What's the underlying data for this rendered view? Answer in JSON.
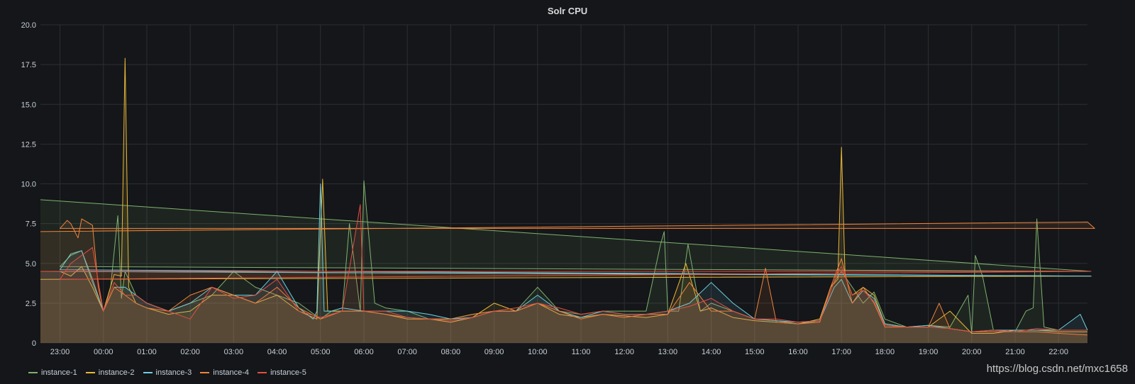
{
  "chart_data": {
    "type": "line",
    "title": "Solr CPU",
    "ylim": [
      0,
      20
    ],
    "y_ticks": [
      "0",
      "2.5",
      "5.0",
      "7.5",
      "10.0",
      "12.5",
      "15.0",
      "17.5",
      "20.0"
    ],
    "x_ticks": [
      "23:00",
      "00:00",
      "01:00",
      "02:00",
      "03:00",
      "04:00",
      "05:00",
      "06:00",
      "07:00",
      "08:00",
      "09:00",
      "10:00",
      "11:00",
      "12:00",
      "13:00",
      "14:00",
      "15:00",
      "16:00",
      "17:00",
      "18:00",
      "19:00",
      "20:00",
      "21:00",
      "22:00"
    ],
    "x_range": [
      "22:33",
      "22:40"
    ],
    "grid": true,
    "legend_position": "bottom-left",
    "series": [
      {
        "name": "instance-1",
        "color": "#7eb26d",
        "x": [
          "22:33",
          "22:45",
          "23:00",
          "23:15",
          "23:30",
          "23:45",
          "00:00",
          "00:10",
          "00:20",
          "00:25",
          "00:30",
          "00:45",
          "01:00",
          "01:30",
          "02:00",
          "02:30",
          "03:00",
          "03:30",
          "04:00",
          "04:30",
          "05:00",
          "05:15",
          "05:30",
          "05:40",
          "05:55",
          "06:00",
          "06:15",
          "06:30",
          "07:00",
          "07:30",
          "08:00",
          "08:30",
          "09:00",
          "09:30",
          "10:00",
          "10:30",
          "11:00",
          "11:30",
          "12:00",
          "12:30",
          "12:50",
          "12:55",
          "13:00",
          "13:15",
          "13:28",
          "13:45",
          "14:00",
          "14:30",
          "15:00",
          "15:30",
          "16:00",
          "16:30",
          "16:45",
          "17:00",
          "17:15",
          "17:30",
          "17:45",
          "18:00",
          "18:30",
          "19:00",
          "19:30",
          "19:55",
          "20:00",
          "20:05",
          "20:15",
          "20:30",
          "21:00",
          "21:15",
          "21:25",
          "21:30",
          "21:40",
          "22:00",
          "22:40"
        ],
        "y": [
          9.0,
          4.5,
          4.8,
          5.5,
          5.8,
          3.8,
          2.0,
          3.5,
          8.0,
          2.8,
          4.5,
          3.0,
          2.5,
          2.0,
          2.5,
          3.0,
          4.5,
          3.5,
          3.0,
          2.5,
          1.5,
          2.0,
          2.0,
          7.5,
          2.0,
          10.2,
          2.5,
          2.2,
          2.0,
          1.5,
          1.5,
          1.8,
          2.0,
          2.0,
          3.5,
          2.0,
          1.8,
          2.0,
          2.0,
          2.0,
          6.2,
          7.0,
          2.0,
          2.0,
          6.2,
          2.0,
          2.5,
          2.0,
          1.5,
          1.4,
          1.2,
          1.4,
          3.5,
          4.5,
          3.5,
          2.5,
          3.2,
          1.5,
          1.0,
          1.1,
          1.0,
          3.0,
          0.6,
          5.5,
          4.2,
          0.8,
          0.7,
          2.0,
          2.2,
          7.8,
          1.0,
          0.8,
          0.8
        ]
      },
      {
        "name": "instance-2",
        "color": "#eab839",
        "x": [
          "22:33",
          "22:45",
          "23:00",
          "23:15",
          "23:30",
          "23:45",
          "00:00",
          "00:15",
          "00:25",
          "00:30",
          "00:35",
          "00:45",
          "01:00",
          "01:30",
          "02:00",
          "02:30",
          "03:00",
          "03:30",
          "04:00",
          "04:30",
          "04:55",
          "05:03",
          "05:10",
          "05:30",
          "06:00",
          "06:30",
          "07:00",
          "07:30",
          "08:00",
          "08:30",
          "09:00",
          "09:30",
          "10:00",
          "10:30",
          "11:00",
          "11:30",
          "12:00",
          "12:30",
          "13:00",
          "13:25",
          "13:45",
          "14:00",
          "14:30",
          "15:00",
          "15:30",
          "16:00",
          "16:30",
          "16:45",
          "16:55",
          "17:00",
          "17:05",
          "17:15",
          "17:30",
          "17:45",
          "18:00",
          "18:30",
          "19:00",
          "19:30",
          "20:00",
          "20:30",
          "21:00",
          "21:30",
          "22:00",
          "22:40"
        ],
        "y": [
          4.0,
          4.2,
          4.5,
          4.2,
          4.8,
          3.5,
          2.0,
          4.3,
          4.2,
          17.9,
          3.5,
          2.5,
          2.2,
          1.8,
          2.0,
          3.0,
          3.0,
          2.5,
          3.0,
          2.0,
          1.5,
          10.3,
          2.0,
          2.0,
          2.0,
          1.8,
          1.5,
          1.5,
          1.3,
          1.6,
          2.5,
          2.0,
          2.5,
          1.8,
          1.6,
          1.8,
          1.7,
          1.6,
          1.8,
          5.0,
          2.0,
          2.2,
          1.6,
          1.4,
          1.3,
          1.2,
          1.5,
          3.5,
          4.0,
          12.3,
          4.2,
          3.0,
          3.5,
          3.0,
          1.2,
          1.0,
          1.0,
          2.0,
          0.6,
          0.6,
          0.8,
          0.8,
          0.7,
          0.7
        ]
      },
      {
        "name": "instance-3",
        "color": "#6ed0e0",
        "x": [
          "22:33",
          "22:45",
          "23:00",
          "23:15",
          "23:30",
          "23:45",
          "00:00",
          "00:15",
          "00:30",
          "00:45",
          "01:00",
          "01:30",
          "02:00",
          "02:30",
          "03:00",
          "03:30",
          "04:00",
          "04:30",
          "04:50",
          "04:55",
          "05:00",
          "05:05",
          "05:15",
          "05:30",
          "06:00",
          "06:30",
          "07:00",
          "07:30",
          "08:00",
          "08:30",
          "09:00",
          "09:30",
          "10:00",
          "10:30",
          "11:00",
          "11:30",
          "12:00",
          "12:30",
          "13:00",
          "13:30",
          "14:00",
          "14:30",
          "15:00",
          "15:30",
          "16:00",
          "16:30",
          "16:50",
          "17:00",
          "17:15",
          "17:30",
          "17:45",
          "18:00",
          "18:30",
          "19:00",
          "19:30",
          "20:00",
          "20:30",
          "21:00",
          "21:30",
          "22:00",
          "22:30",
          "22:40"
        ],
        "y": [
          4.5,
          4.2,
          4.6,
          5.6,
          5.8,
          4.0,
          2.0,
          3.5,
          3.5,
          3.0,
          2.5,
          2.0,
          2.5,
          3.5,
          3.0,
          3.0,
          4.5,
          2.2,
          1.5,
          2.0,
          10.0,
          2.0,
          2.0,
          2.2,
          2.0,
          2.0,
          2.0,
          1.8,
          1.5,
          1.6,
          2.0,
          2.0,
          3.0,
          2.0,
          1.6,
          2.0,
          1.8,
          1.8,
          2.0,
          2.5,
          3.8,
          2.5,
          1.5,
          1.4,
          1.3,
          1.4,
          3.5,
          4.0,
          2.5,
          3.3,
          2.8,
          1.2,
          1.0,
          1.1,
          0.9,
          0.7,
          0.8,
          0.8,
          0.8,
          0.8,
          1.8,
          0.8
        ]
      },
      {
        "name": "instance-4",
        "color": "#ef843c",
        "x": [
          "22:33",
          "22:40",
          "22:50",
          "23:00",
          "23:10",
          "23:15",
          "23:25",
          "23:30",
          "23:45",
          "23:53",
          "00:00",
          "00:15",
          "00:30",
          "00:45",
          "01:00",
          "01:30",
          "02:00",
          "02:30",
          "03:00",
          "03:30",
          "04:00",
          "04:30",
          "05:00",
          "05:30",
          "06:00",
          "06:30",
          "07:00",
          "07:30",
          "08:00",
          "08:30",
          "09:00",
          "09:30",
          "10:00",
          "10:30",
          "11:00",
          "11:30",
          "12:00",
          "12:30",
          "13:00",
          "13:30",
          "14:00",
          "14:30",
          "15:00",
          "15:15",
          "15:30",
          "16:00",
          "16:30",
          "16:45",
          "17:00",
          "17:15",
          "17:30",
          "17:45",
          "18:00",
          "18:30",
          "19:00",
          "19:15",
          "19:30",
          "20:00",
          "20:30",
          "21:00",
          "21:30",
          "22:00",
          "22:40"
        ],
        "y": [
          7.0,
          7.6,
          7.2,
          7.2,
          7.7,
          7.5,
          6.6,
          7.8,
          7.4,
          3.5,
          2.0,
          3.5,
          3.0,
          2.5,
          2.2,
          2.0,
          3.0,
          3.5,
          3.0,
          2.5,
          3.5,
          2.2,
          1.5,
          2.0,
          2.0,
          1.8,
          1.6,
          1.5,
          1.5,
          1.8,
          2.0,
          2.0,
          2.5,
          2.0,
          1.5,
          1.8,
          1.6,
          1.8,
          1.8,
          3.8,
          2.0,
          2.0,
          1.5,
          4.7,
          1.3,
          1.2,
          1.3,
          3.5,
          5.3,
          2.5,
          3.5,
          2.5,
          1.0,
          1.0,
          1.0,
          2.5,
          0.9,
          0.7,
          0.7,
          0.7,
          0.7,
          0.6,
          0.5
        ]
      },
      {
        "name": "instance-5",
        "color": "#e24d42",
        "x": [
          "22:33",
          "22:45",
          "23:00",
          "23:15",
          "23:30",
          "23:45",
          "00:00",
          "00:15",
          "00:30",
          "00:45",
          "01:00",
          "01:30",
          "02:00",
          "02:30",
          "03:00",
          "03:30",
          "04:00",
          "04:30",
          "05:00",
          "05:30",
          "05:55",
          "06:00",
          "06:05",
          "06:30",
          "07:00",
          "07:30",
          "08:00",
          "08:30",
          "09:00",
          "09:30",
          "10:00",
          "10:30",
          "11:00",
          "11:30",
          "12:00",
          "12:30",
          "13:00",
          "13:30",
          "14:00",
          "14:30",
          "15:00",
          "15:30",
          "16:00",
          "16:30",
          "16:55",
          "17:00",
          "17:15",
          "17:30",
          "17:45",
          "18:00",
          "18:30",
          "19:00",
          "19:30",
          "20:00",
          "20:30",
          "21:00",
          "21:30",
          "22:00",
          "22:40"
        ],
        "y": [
          4.5,
          4.5,
          4.0,
          5.0,
          5.5,
          6.0,
          2.0,
          3.8,
          3.0,
          3.0,
          2.5,
          2.0,
          1.5,
          3.5,
          2.8,
          3.0,
          4.0,
          2.0,
          1.6,
          2.0,
          8.7,
          2.0,
          2.0,
          2.0,
          1.6,
          1.5,
          1.4,
          1.6,
          2.0,
          2.2,
          2.5,
          2.2,
          1.8,
          2.0,
          1.8,
          1.8,
          2.0,
          2.3,
          2.8,
          2.0,
          1.5,
          1.5,
          1.3,
          1.4,
          4.5,
          4.8,
          3.0,
          3.3,
          2.6,
          1.1,
          1.0,
          1.0,
          0.9,
          0.7,
          0.8,
          0.7,
          0.9,
          0.8,
          0.8
        ]
      }
    ]
  },
  "watermark": "https://blog.csdn.net/mxc1658"
}
